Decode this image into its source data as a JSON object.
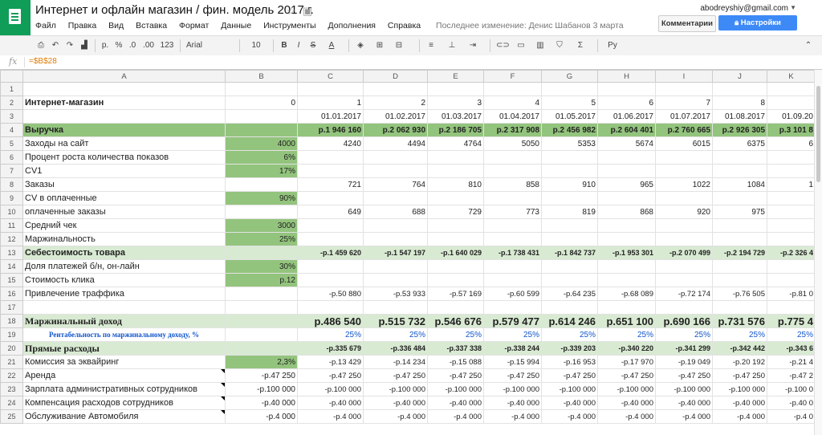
{
  "doc_title": "Интернет и офлайн магазин / фин. модель 2017 г.",
  "menu": [
    "Файл",
    "Правка",
    "Вид",
    "Вставка",
    "Формат",
    "Данные",
    "Инструменты",
    "Дополнения",
    "Справка"
  ],
  "last_edit": "Последнее изменение: Денис Шабанов 3 марта",
  "user_email": "abodreyshiy@gmail.com",
  "buttons": {
    "comments": "Комментарии",
    "share": "Настройки доступа"
  },
  "toolbar": {
    "currency": "р.",
    "percent": "%",
    "dec_less": ".0",
    "dec_more": ".00",
    "format_more": "123",
    "font": "Arial",
    "size": "10",
    "input_tools": "Ру"
  },
  "formula": "=$B$28",
  "columns": [
    "",
    "A",
    "B",
    "C",
    "D",
    "E",
    "F",
    "G",
    "H",
    "I",
    "J",
    "K"
  ],
  "rows": [
    {
      "n": "1",
      "a": "",
      "b": "",
      "v": [
        "",
        "",
        "",
        "",
        "",
        "",
        "",
        "",
        ""
      ]
    },
    {
      "n": "2",
      "a": "Интернет-магазин",
      "b": "0",
      "v": [
        "1",
        "2",
        "3",
        "4",
        "5",
        "6",
        "7",
        "8",
        ""
      ]
    },
    {
      "n": "3",
      "a": "",
      "b": "",
      "v": [
        "01.01.2017",
        "01.02.2017",
        "01.03.2017",
        "01.04.2017",
        "01.05.2017",
        "01.06.2017",
        "01.07.2017",
        "01.08.2017",
        "01.09.20"
      ]
    },
    {
      "n": "4",
      "a": "Выручка",
      "b": "",
      "v": [
        "р.1 946 160",
        "р.2 062 930",
        "р.2 186 705",
        "р.2 317 908",
        "р.2 456 982",
        "р.2 604 401",
        "р.2 760 665",
        "р.2 926 305",
        "р.3 101 8"
      ]
    },
    {
      "n": "5",
      "a": "Заходы на сайт",
      "b": "4000",
      "v": [
        "4240",
        "4494",
        "4764",
        "5050",
        "5353",
        "5674",
        "6015",
        "6375",
        "6"
      ]
    },
    {
      "n": "6",
      "a": "Процент роста количества показов",
      "b": "6%",
      "v": [
        "",
        "",
        "",
        "",
        "",
        "",
        "",
        "",
        ""
      ]
    },
    {
      "n": "7",
      "a": "CV1",
      "b": "17%",
      "v": [
        "",
        "",
        "",
        "",
        "",
        "",
        "",
        "",
        ""
      ]
    },
    {
      "n": "8",
      "a": "Заказы",
      "b": "",
      "v": [
        "721",
        "764",
        "810",
        "858",
        "910",
        "965",
        "1022",
        "1084",
        "1"
      ]
    },
    {
      "n": "9",
      "a": "CV в оплаченные",
      "b": "90%",
      "v": [
        "",
        "",
        "",
        "",
        "",
        "",
        "",
        "",
        ""
      ]
    },
    {
      "n": "10",
      "a": "оплаченные заказы",
      "b": "",
      "v": [
        "649",
        "688",
        "729",
        "773",
        "819",
        "868",
        "920",
        "975",
        ""
      ]
    },
    {
      "n": "11",
      "a": "Средний чек",
      "b": "3000",
      "v": [
        "",
        "",
        "",
        "",
        "",
        "",
        "",
        "",
        ""
      ]
    },
    {
      "n": "12",
      "a": "Маржинальность",
      "b": "25%",
      "v": [
        "",
        "",
        "",
        "",
        "",
        "",
        "",
        "",
        ""
      ]
    },
    {
      "n": "13",
      "a": "Себестоимость товара",
      "b": "",
      "v": [
        "-р.1 459 620",
        "-р.1 547 197",
        "-р.1 640 029",
        "-р.1 738 431",
        "-р.1 842 737",
        "-р.1 953 301",
        "-р.2 070 499",
        "-р.2 194 729",
        "-р.2 326 4"
      ]
    },
    {
      "n": "14",
      "a": "Доля платежей б/н, он-лайн",
      "b": "30%",
      "v": [
        "",
        "",
        "",
        "",
        "",
        "",
        "",
        "",
        ""
      ]
    },
    {
      "n": "15",
      "a": "Стоимость клика",
      "b": "р.12",
      "v": [
        "",
        "",
        "",
        "",
        "",
        "",
        "",
        "",
        ""
      ]
    },
    {
      "n": "16",
      "a": "Привлечение траффика",
      "b": "",
      "v": [
        "-р.50 880",
        "-р.53 933",
        "-р.57 169",
        "-р.60 599",
        "-р.64 235",
        "-р.68 089",
        "-р.72 174",
        "-р.76 505",
        "-р.81 0"
      ]
    },
    {
      "n": "17",
      "a": "",
      "b": "",
      "v": [
        "",
        "",
        "",
        "",
        "",
        "",
        "",
        "",
        ""
      ]
    },
    {
      "n": "18",
      "a": "Маржинальный доход",
      "b": "",
      "v": [
        "р.486 540",
        "р.515 732",
        "р.546 676",
        "р.579 477",
        "р.614 246",
        "р.651 100",
        "р.690 166",
        "р.731 576",
        "р.775 4"
      ]
    },
    {
      "n": "19",
      "a": "Рентабельность по маржинальному доходу, %",
      "b": "",
      "v": [
        "25%",
        "25%",
        "25%",
        "25%",
        "25%",
        "25%",
        "25%",
        "25%",
        "25%"
      ]
    },
    {
      "n": "20",
      "a": "Прямые расходы",
      "b": "",
      "v": [
        "-р.335 679",
        "-р.336 484",
        "-р.337 338",
        "-р.338 244",
        "-р.339 203",
        "-р.340 220",
        "-р.341 299",
        "-р.342 442",
        "-р.343 6"
      ]
    },
    {
      "n": "21",
      "a": "Комиссия за эквайринг",
      "b": "2,3%",
      "v": [
        "-р.13 429",
        "-р.14 234",
        "-р.15 088",
        "-р.15 994",
        "-р.16 953",
        "-р.17 970",
        "-р.19 049",
        "-р.20 192",
        "-р.21 4"
      ]
    },
    {
      "n": "22",
      "a": "Аренда",
      "b": "-р.47 250",
      "v": [
        "-р.47 250",
        "-р.47 250",
        "-р.47 250",
        "-р.47 250",
        "-р.47 250",
        "-р.47 250",
        "-р.47 250",
        "-р.47 250",
        "-р.47 2"
      ]
    },
    {
      "n": "23",
      "a": "Зарплата административных сотрудников",
      "b": "-р.100 000",
      "v": [
        "-р.100 000",
        "-р.100 000",
        "-р.100 000",
        "-р.100 000",
        "-р.100 000",
        "-р.100 000",
        "-р.100 000",
        "-р.100 000",
        "-р.100 0"
      ]
    },
    {
      "n": "24",
      "a": "Компенсация расходов сотрудников",
      "b": "-р.40 000",
      "v": [
        "-р.40 000",
        "-р.40 000",
        "-р.40 000",
        "-р.40 000",
        "-р.40 000",
        "-р.40 000",
        "-р.40 000",
        "-р.40 000",
        "-р.40 0"
      ]
    },
    {
      "n": "25",
      "a": "Обслуживание Автомобиля",
      "b": "-р.4 000",
      "v": [
        "-р.4 000",
        "-р.4 000",
        "-р.4 000",
        "-р.4 000",
        "-р.4 000",
        "-р.4 000",
        "-р.4 000",
        "-р.4 000",
        "-р.4 0"
      ]
    }
  ],
  "colors": {
    "green": "#93c47d",
    "light_green": "#d9ead3",
    "brand": "#0f9d58",
    "share": "#3d8af7"
  }
}
